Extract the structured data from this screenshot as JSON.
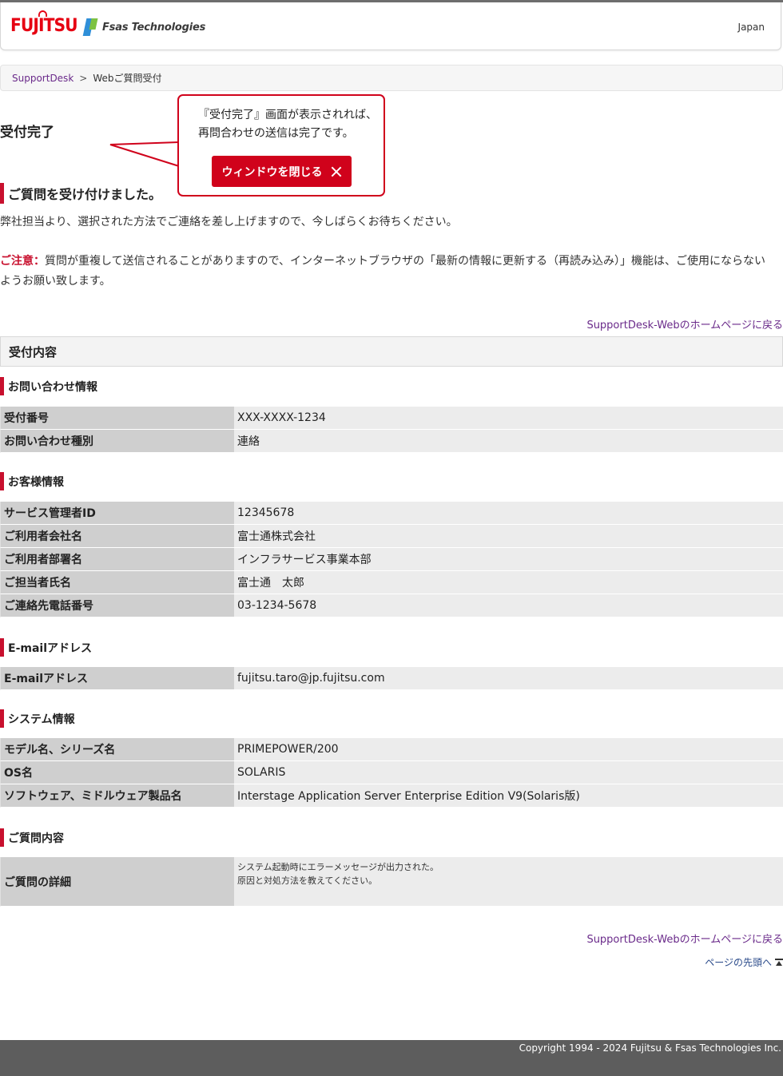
{
  "header": {
    "brand_fujitsu": "FUJITSU",
    "brand_fsas": "Fsas Technologies",
    "region": "Japan"
  },
  "breadcrumb": {
    "home": "SupportDesk",
    "separator": ">",
    "current": "Webご質問受付"
  },
  "page_title": "受付完了",
  "callout": {
    "line1": "『受付完了』画面が表示されれば、",
    "line2": "再問合わせの送信は完了です。",
    "button_label": "ウィンドウを閉じる"
  },
  "received": {
    "heading": "ご質問を受け付けました。",
    "message": "弊社担当より、選択された方法でご連絡を差し上げますので、今しばらくお待ちください。",
    "caution_label": "ご注意：",
    "caution_line1": "質問が重複して送信されることがありますので、インターネットブラウザの「最新の情報に更新する（再読み込み）」機能は、ご使用にならない",
    "caution_line2": "ようお願い致します。"
  },
  "home_link": "SupportDesk-Webのホームページに戻る",
  "panel_title": "受付内容",
  "sections": {
    "inquiry": {
      "title": "お問い合わせ情報",
      "rows": [
        {
          "label": "受付番号",
          "value": "XXX-XXXX-1234"
        },
        {
          "label": "お問い合わせ種別",
          "value": "連絡"
        }
      ]
    },
    "customer": {
      "title": "お客様情報",
      "rows": [
        {
          "label": "サービス管理者ID",
          "value": "12345678"
        },
        {
          "label": "ご利用者会社名",
          "value": "富士通株式会社"
        },
        {
          "label": "ご利用者部署名",
          "value": "インフラサービス事業本部"
        },
        {
          "label": "ご担当者氏名",
          "value": "富士通　太郎"
        },
        {
          "label": "ご連絡先電話番号",
          "value": "03-1234-5678"
        }
      ]
    },
    "email": {
      "title": "E-mailアドレス",
      "rows": [
        {
          "label": "E-mailアドレス",
          "value": "fujitsu.taro@jp.fujitsu.com"
        }
      ]
    },
    "system": {
      "title": "システム情報",
      "rows": [
        {
          "label": "モデル名、シリーズ名",
          "value": "PRIMEPOWER/200"
        },
        {
          "label": "OS名",
          "value": "SOLARIS"
        },
        {
          "label": "ソフトウェア、ミドルウェア製品名",
          "value": "Interstage Application Server Enterprise Edition V9(Solaris版)"
        }
      ]
    },
    "question": {
      "title": "ご質問内容",
      "label": "ご質問の詳細",
      "line1": "システム起動時にエラーメッセージが出力された。",
      "line2": "原因と対処方法を教えてください。"
    }
  },
  "to_top": "ページの先頭へ",
  "footer": "Copyright 1994 - 2024 Fujitsu & Fsas Technologies Inc."
}
